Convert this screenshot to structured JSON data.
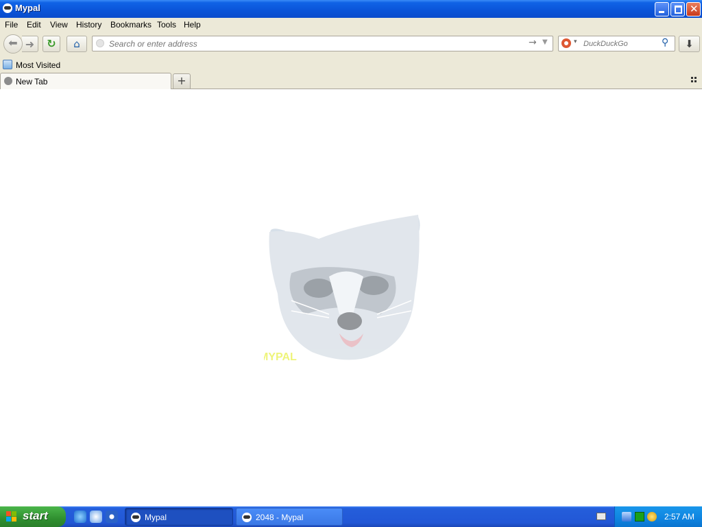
{
  "window": {
    "title": "Mypal"
  },
  "menu": {
    "items": [
      "File",
      "Edit",
      "View",
      "History",
      "Bookmarks",
      "Tools",
      "Help"
    ]
  },
  "navbar": {
    "url_placeholder": "Search or enter address",
    "url_value": "",
    "search_placeholder": "DuckDuckGo"
  },
  "bookmarks": {
    "items": [
      {
        "label": "Most Visited",
        "icon": "folder-icon"
      }
    ]
  },
  "tabs": [
    {
      "label": "New Tab",
      "icon": "globe-icon",
      "active": true
    }
  ],
  "content": {
    "logo_text": "MYPAL"
  },
  "taskbar": {
    "start_label": "start",
    "quick_launch": [
      "ie-icon",
      "outlook-icon",
      "media-player-icon"
    ],
    "tasks": [
      {
        "label": "Mypal",
        "active": true
      },
      {
        "label": "2048 - Mypal",
        "active": false
      }
    ],
    "clock": "2:57 AM"
  },
  "colors": {
    "titlebar": "#0a54d8",
    "chrome": "#ece9d8",
    "taskbar": "#245edb",
    "start": "#3a9a3a",
    "tray": "#0f84e0"
  }
}
